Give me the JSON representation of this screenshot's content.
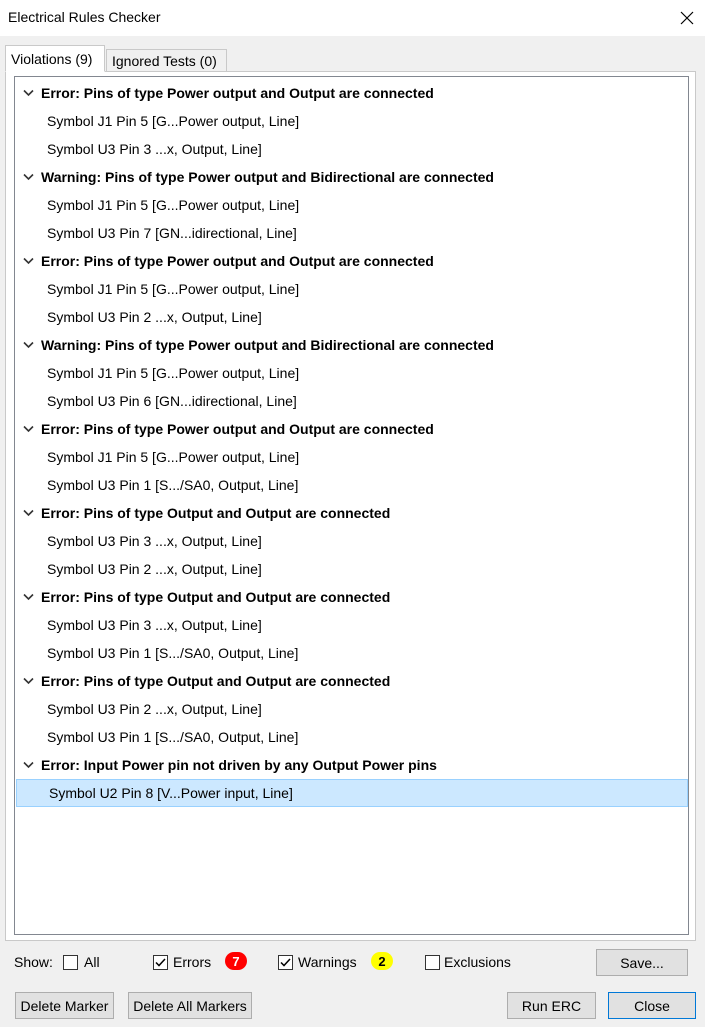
{
  "window": {
    "title": "Electrical Rules Checker"
  },
  "tabs": [
    {
      "label": "Violations (9)"
    },
    {
      "label": "Ignored Tests (0)"
    }
  ],
  "violations": [
    {
      "header": "Error: Pins of type Power output and Output are connected",
      "items": [
        "Symbol J1 Pin 5 [G...Power output, Line]",
        "Symbol U3 Pin 3 ...x, Output, Line]"
      ]
    },
    {
      "header": "Warning: Pins of type Power output and Bidirectional are connected",
      "items": [
        "Symbol J1 Pin 5 [G...Power output, Line]",
        "Symbol U3 Pin 7 [GN...idirectional, Line]"
      ]
    },
    {
      "header": "Error: Pins of type Power output and Output are connected",
      "items": [
        "Symbol J1 Pin 5 [G...Power output, Line]",
        "Symbol U3 Pin 2 ...x, Output, Line]"
      ]
    },
    {
      "header": "Warning: Pins of type Power output and Bidirectional are connected",
      "items": [
        "Symbol J1 Pin 5 [G...Power output, Line]",
        "Symbol U3 Pin 6 [GN...idirectional, Line]"
      ]
    },
    {
      "header": "Error: Pins of type Power output and Output are connected",
      "items": [
        "Symbol J1 Pin 5 [G...Power output, Line]",
        "Symbol U3 Pin 1 [S.../SA0, Output, Line]"
      ]
    },
    {
      "header": "Error: Pins of type Output and Output are connected",
      "items": [
        "Symbol U3 Pin 3 ...x, Output, Line]",
        "Symbol U3 Pin 2 ...x, Output, Line]"
      ]
    },
    {
      "header": "Error: Pins of type Output and Output are connected",
      "items": [
        "Symbol U3 Pin 3 ...x, Output, Line]",
        "Symbol U3 Pin 1 [S.../SA0, Output, Line]"
      ]
    },
    {
      "header": "Error: Pins of type Output and Output are connected",
      "items": [
        "Symbol U3 Pin 2 ...x, Output, Line]",
        "Symbol U3 Pin 1 [S.../SA0, Output, Line]"
      ]
    },
    {
      "header": "Error: Input Power pin not driven by any Output Power pins",
      "items": [
        "Symbol U2 Pin 8 [V...Power input, Line]"
      ]
    }
  ],
  "selected_item": "Symbol U2 Pin 8 [V...Power input, Line]",
  "filter": {
    "show_label": "Show:",
    "all": {
      "label": "All",
      "checked": false
    },
    "errors": {
      "label": "Errors",
      "checked": true,
      "count": "7",
      "badge_color": "#ff0000"
    },
    "warnings": {
      "label": "Warnings",
      "checked": true,
      "count": "2",
      "badge_color": "#ffff00"
    },
    "exclusions": {
      "label": "Exclusions",
      "checked": false
    }
  },
  "buttons": {
    "save": "Save...",
    "delete_marker": "Delete Marker",
    "delete_all_markers": "Delete All Markers",
    "run_erc": "Run ERC",
    "close": "Close"
  },
  "icons": {
    "close": "close-icon",
    "expand": "chevron-down-icon",
    "check": "check-icon"
  }
}
